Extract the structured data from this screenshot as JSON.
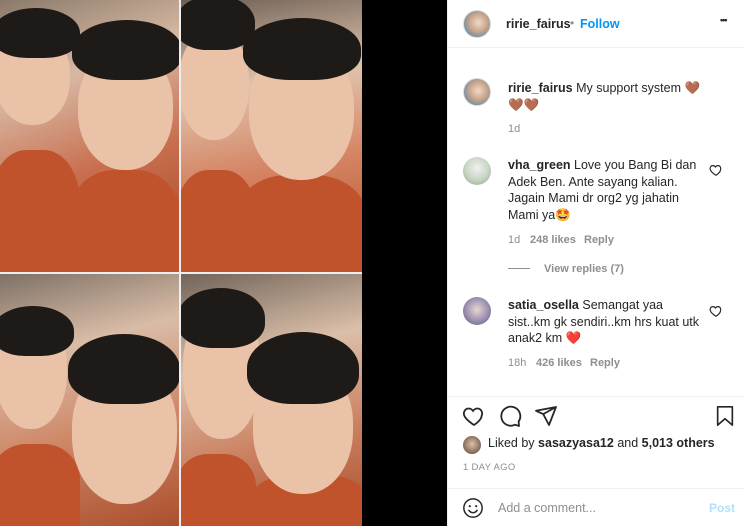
{
  "post": {
    "image_alt": "Two boys making funny faces, four-photo collage",
    "author": "ririe_fairus",
    "follow_label": "Follow",
    "separator": "•",
    "more_label": "•••"
  },
  "caption": {
    "username": "ririe_fairus",
    "text": "My support system",
    "emoji": "🤎🤎🤎",
    "time": "1d"
  },
  "comments": [
    {
      "username": "vha_green",
      "text": "Love you Bang Bi dan Adek Ben. Ante sayang kalian. Jagain Mami dr org2 yg jahatin Mami ya🤩",
      "time": "1d",
      "likes": "248 likes",
      "reply": "Reply",
      "view_replies": "View replies (7)"
    },
    {
      "username": "satia_osella",
      "text": "Semangat yaa sist..km gk sendiri..km hrs kuat utk anak2 km ❤️",
      "time": "18h",
      "likes": "426 likes",
      "reply": "Reply"
    }
  ],
  "likes": {
    "prefix": "Liked by",
    "user": "sasazyasa12",
    "middle": "and",
    "count": "5,013 others"
  },
  "timestamp": "1 DAY AGO",
  "add_comment": {
    "placeholder": "Add a comment...",
    "post_label": "Post"
  },
  "icons": {
    "like": "heart-icon",
    "comment": "comment-icon",
    "share": "paper-plane-icon",
    "save": "bookmark-icon",
    "emoji": "smiley-icon",
    "more": "more-icon"
  },
  "colors": {
    "link_blue": "#0095f6",
    "post_disabled": "#b2dffc",
    "muted": "#8e8e8e",
    "text": "#262626"
  }
}
